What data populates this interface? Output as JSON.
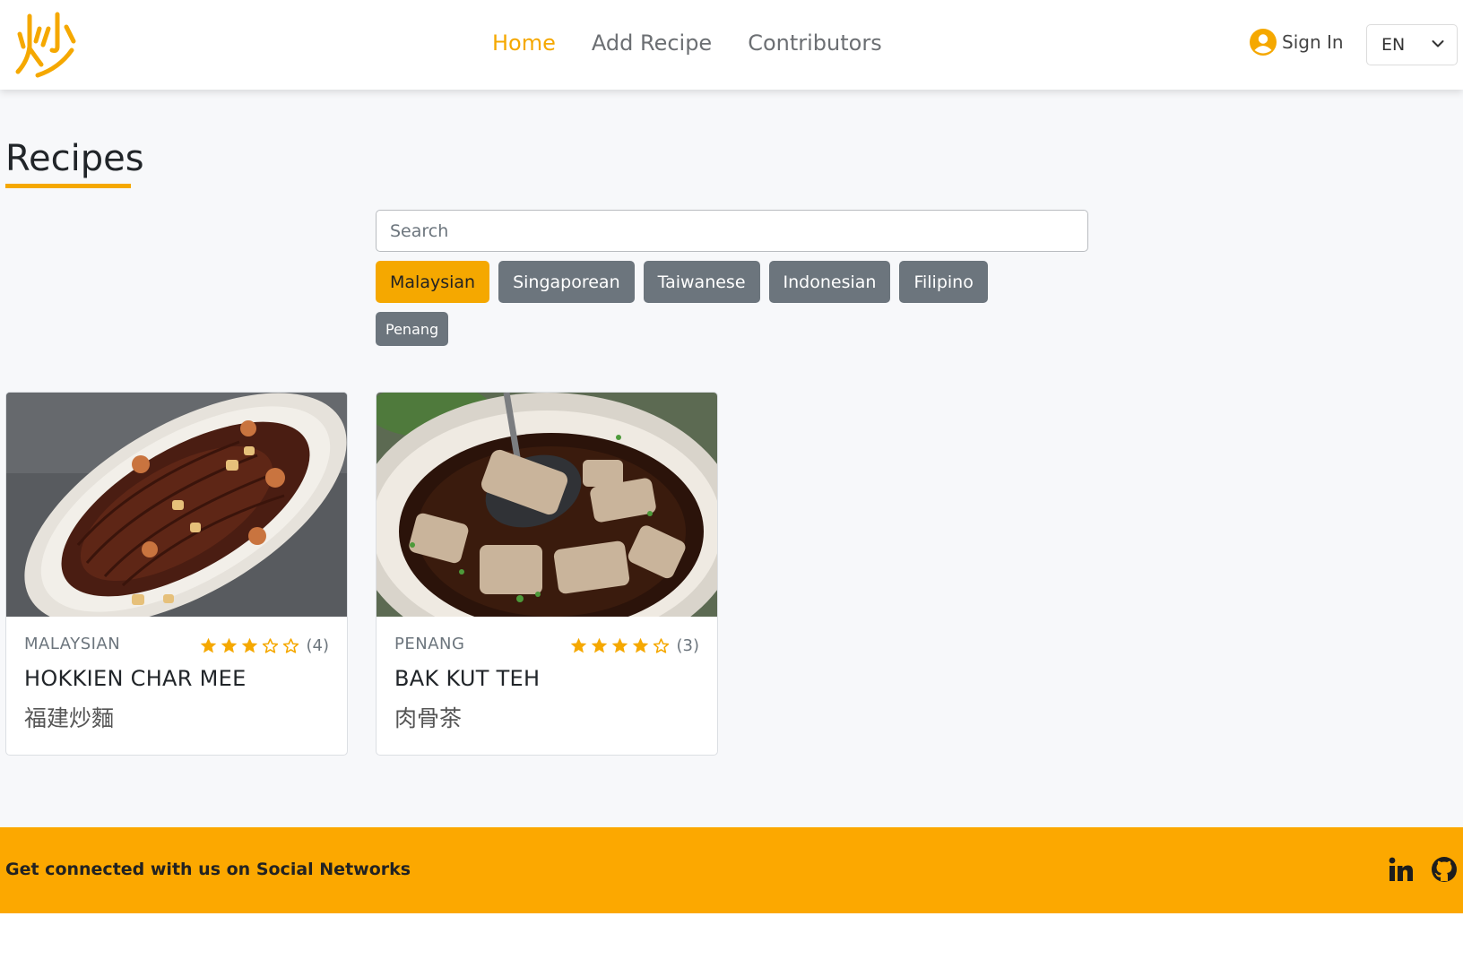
{
  "nav": {
    "links": [
      {
        "label": "Home",
        "active": true
      },
      {
        "label": "Add Recipe",
        "active": false
      },
      {
        "label": "Contributors",
        "active": false
      }
    ],
    "sign_in": "Sign In",
    "language": "EN"
  },
  "page": {
    "title": "Recipes",
    "search_placeholder": "Search"
  },
  "filters": {
    "cuisines": [
      {
        "label": "Malaysian",
        "active": true
      },
      {
        "label": "Singaporean",
        "active": false
      },
      {
        "label": "Taiwanese",
        "active": false
      },
      {
        "label": "Indonesian",
        "active": false
      },
      {
        "label": "Filipino",
        "active": false
      }
    ],
    "sub_regions": [
      "Penang"
    ]
  },
  "recipes": [
    {
      "cuisine": "MALAYSIAN",
      "name": "HOKKIEN CHAR MEE",
      "chinese": "福建炒麵",
      "rating": 3,
      "max_rating": 5,
      "reviews": "(4)"
    },
    {
      "cuisine": "PENANG",
      "name": "BAK KUT TEH",
      "chinese": "肉骨茶",
      "rating": 4,
      "max_rating": 5,
      "reviews": "(3)"
    }
  ],
  "footer": {
    "text": "Get connected with us on Social Networks"
  },
  "colors": {
    "accent": "#f5a800",
    "footer": "#fca800",
    "filter_inactive": "#6c757d"
  },
  "icons": [
    "logo-chao-icon",
    "user-circle-icon",
    "chevron-down-icon",
    "star-icon",
    "linkedin-icon",
    "github-icon"
  ]
}
